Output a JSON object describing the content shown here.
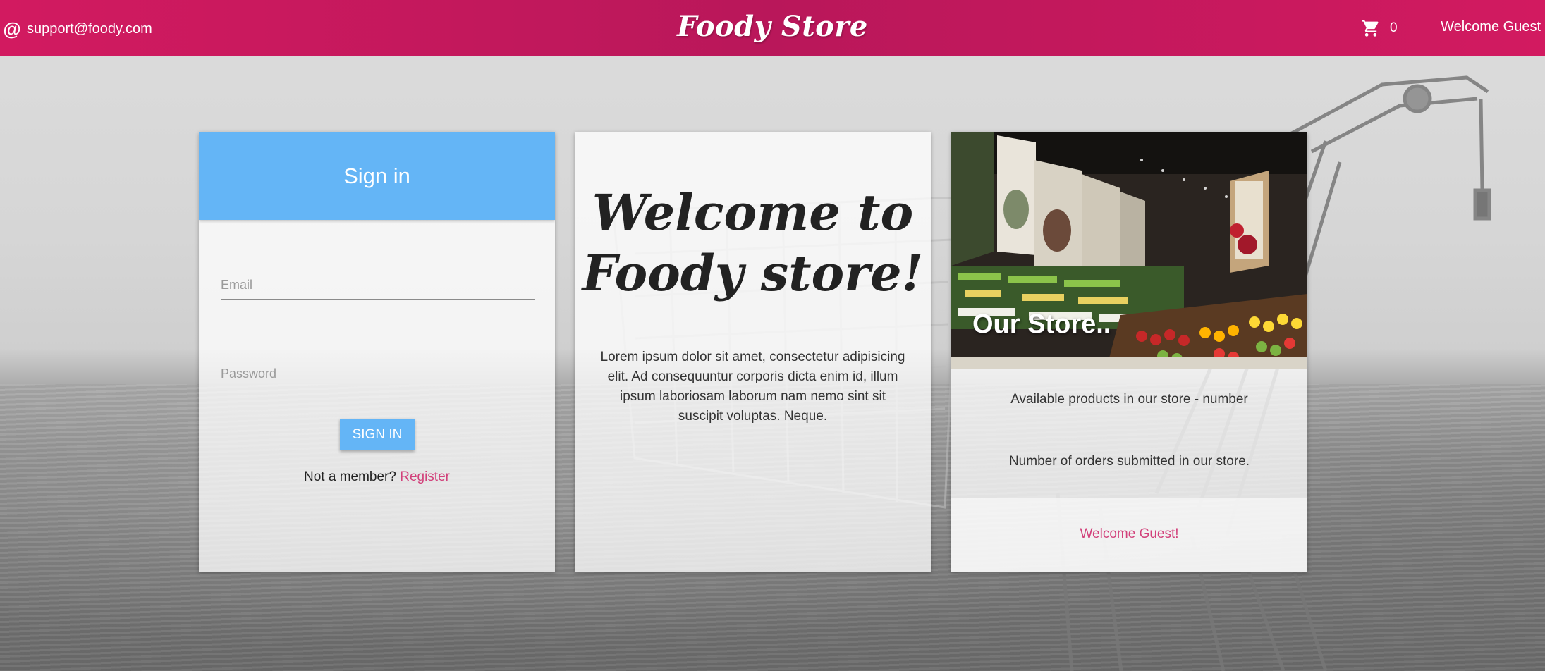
{
  "colors": {
    "header": "#c2185b",
    "accent_blue": "#64b5f6",
    "link_pink": "#d2407a"
  },
  "header": {
    "support_icon": "at-icon",
    "support_email": "support@foody.com",
    "brand": "Foody Store",
    "cart_icon": "cart-icon",
    "cart_count": "0",
    "welcome": "Welcome Guest"
  },
  "signin": {
    "title": "Sign in",
    "email_placeholder": "Email",
    "password_placeholder": "Password",
    "button": "SIGN IN",
    "member_text": "Not a member?",
    "register_link": "Register"
  },
  "welcome_card": {
    "title_line1": "Welcome to",
    "title_line2": "Foody store!",
    "body": "Lorem ipsum dolor sit amet, consectetur adipisicing elit. Ad consequuntur corporis dicta enim id, illum ipsum laboriosam laborum nam nemo sint sit suscipit voluptas. Neque."
  },
  "store_card": {
    "photo_title": "Our Store..",
    "products_line": "Available products in our store - number",
    "orders_line": "Number of orders submitted in our store.",
    "footer_link": "Welcome Guest!"
  }
}
